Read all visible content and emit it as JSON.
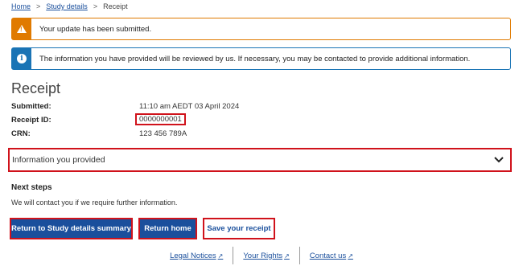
{
  "breadcrumb": {
    "items": [
      "Home",
      "Study details"
    ],
    "current": "Receipt",
    "separator": ">"
  },
  "alerts": {
    "warning": {
      "icon": "warning-triangle-icon",
      "text": "Your update has been submitted.",
      "color": "#e07a00"
    },
    "info": {
      "icon": "info-icon",
      "text": "The information you have provided will be reviewed by us. If necessary, you may be contacted to provide additional information.",
      "color": "#1a74b5"
    }
  },
  "receipt": {
    "title": "Receipt",
    "rows": [
      {
        "label": "Submitted:",
        "value": "11:10 am AEDT 03 April 2024"
      },
      {
        "label": "Receipt ID:",
        "value": "0000000001"
      },
      {
        "label": "CRN:",
        "value": "123 456 789A"
      }
    ]
  },
  "accordion": {
    "label": "Information you provided",
    "icon": "chevron-down-icon"
  },
  "next_steps": {
    "title": "Next steps",
    "text": "We will contact you if we require further information."
  },
  "buttons": {
    "summary": "Return to Study details summary",
    "home": "Return home",
    "save": "Save your receipt"
  },
  "footer": {
    "links": [
      "Legal Notices",
      "Your Rights",
      "Contact us"
    ]
  },
  "colors": {
    "primary": "#1a4f9c",
    "highlight": "#d0121b"
  }
}
